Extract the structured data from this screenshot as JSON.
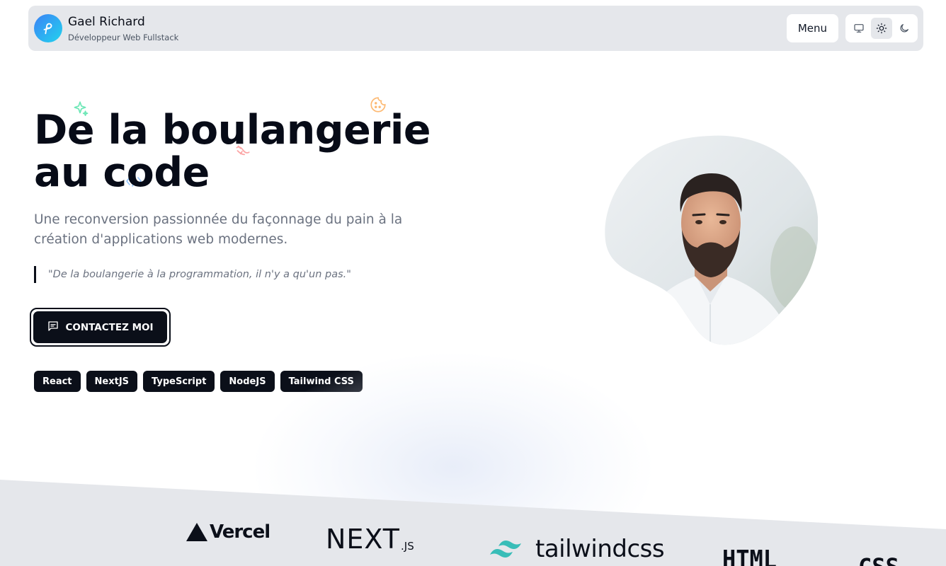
{
  "header": {
    "name": "Gael Richard",
    "subtitle": "Développeur Web Fullstack",
    "menu_label": "Menu",
    "theme_options": [
      "monitor-icon",
      "sun-icon",
      "moon-icon"
    ],
    "active_theme": "sun-icon"
  },
  "hero": {
    "title": "De la boulangerie au code",
    "subtitle": "Une reconversion passionnée du façonnage du pain à la création d'applications web modernes.",
    "quote": "\"De la boulangerie à la programmation, il n'y a qu'un pas.\"",
    "cta_label": "CONTACTEZ MOI",
    "tags": [
      "React",
      "NextJS",
      "TypeScript",
      "NodeJS",
      "Tailwind CSS"
    ]
  },
  "logos": {
    "vercel": "Vercel",
    "next": "NEXT",
    "next_suffix": ".JS",
    "tailwind": "tailwindcss",
    "html": "HTML",
    "css": "CSS"
  },
  "colors": {
    "accent_dark": "#0b0f19",
    "header_bg": "#e5e7eb",
    "logo_gradient_start": "#3b82f6",
    "logo_gradient_end": "#22d3ee",
    "tailwind_teal": "#38bdb8"
  }
}
